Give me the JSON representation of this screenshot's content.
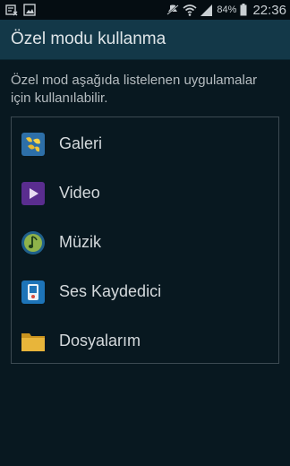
{
  "status_bar": {
    "battery_percent": "84%",
    "time": "22:36"
  },
  "header": {
    "title": "Özel modu kullanma"
  },
  "description": "Özel mod aşağıda listelenen uygulamalar için kullanılabilir.",
  "apps": [
    {
      "label": "Galeri",
      "icon": "gallery-icon"
    },
    {
      "label": "Video",
      "icon": "video-icon"
    },
    {
      "label": "Müzik",
      "icon": "music-icon"
    },
    {
      "label": "Ses Kaydedici",
      "icon": "voice-recorder-icon"
    },
    {
      "label": "Dosyalarım",
      "icon": "my-files-icon"
    }
  ],
  "colors": {
    "background": "#081820",
    "title_bar": "#133848",
    "status_bar": "#050d12"
  }
}
